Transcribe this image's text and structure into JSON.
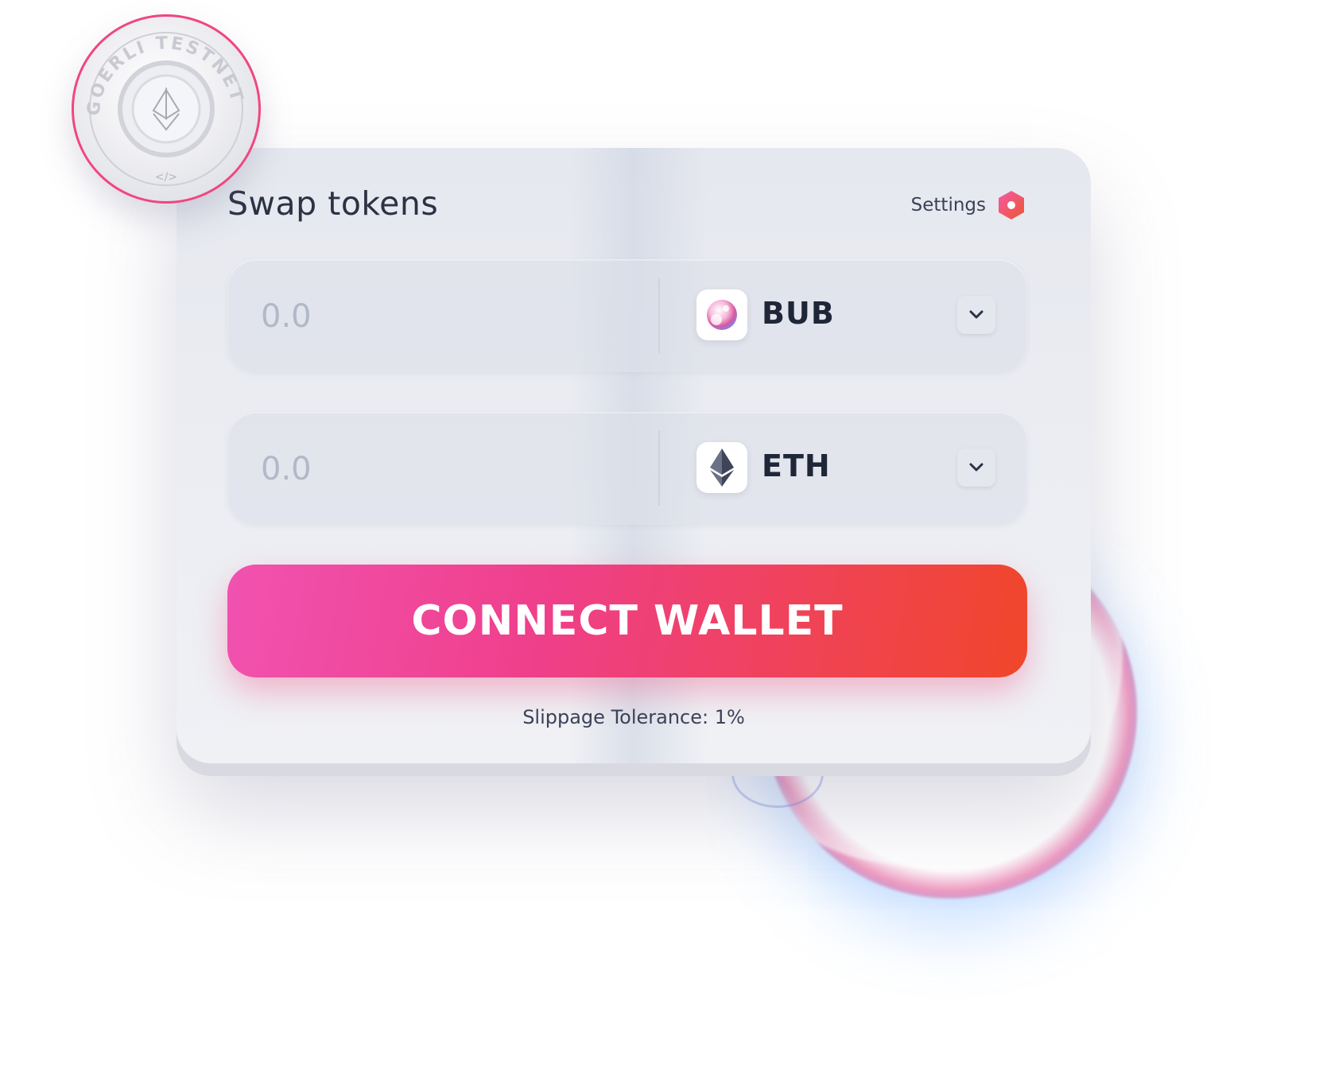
{
  "badge": {
    "text": "GOERLI TESTNET",
    "code_glyph": "</>"
  },
  "card": {
    "title": "Swap tokens",
    "settings_label": "Settings"
  },
  "from": {
    "amount_placeholder": "0.0",
    "token_symbol": "BUB",
    "token_icon": "bub-bubble-icon"
  },
  "to": {
    "amount_placeholder": "0.0",
    "token_symbol": "ETH",
    "token_icon": "ethereum-icon"
  },
  "connect_button_label": "CONNECT WALLET",
  "slippage_text": "Slippage Tolerance: 1%",
  "colors": {
    "accent_start": "#f152b0",
    "accent_end": "#f0462a",
    "text_dark": "#1f2638"
  }
}
